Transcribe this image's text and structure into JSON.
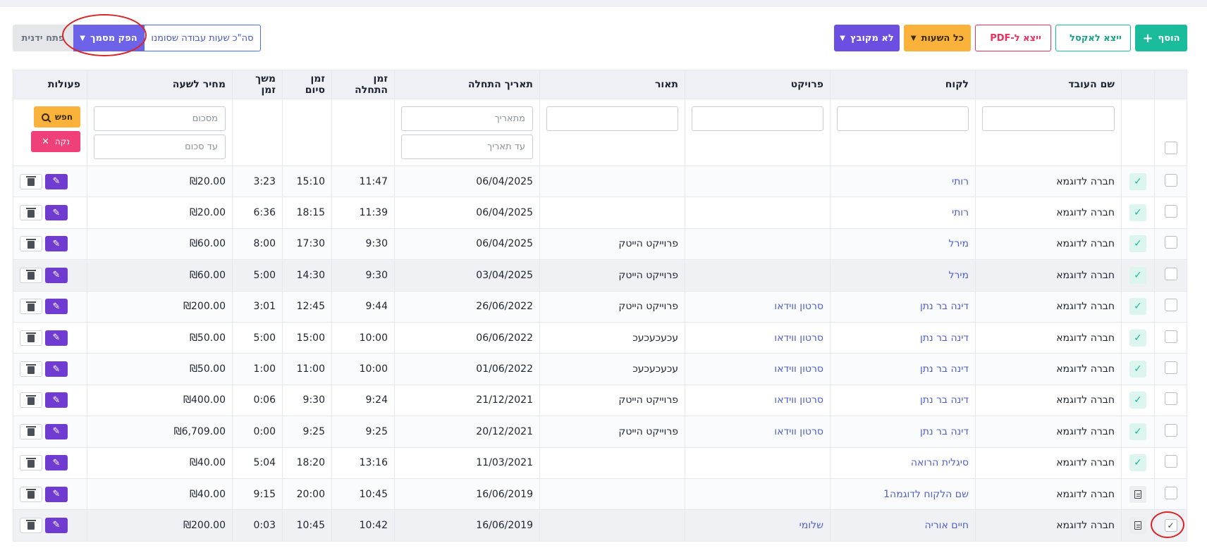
{
  "toolbar": {
    "add_label": "הוסף",
    "export_excel_label": "ייצא לאקסל",
    "export_pdf_label": "ייצא ל-PDF",
    "all_hours_label": "כל השעות",
    "not_grouped_label": "לא מקובץ",
    "manual_open_label": "פתח ידנית",
    "generate_doc_label": "הפק מסמך",
    "total_hours_label": "סה\"כ שעות עבודה שסומנו"
  },
  "table": {
    "headers": {
      "employee": "שם העובד",
      "client": "לקוח",
      "project": "פרויקט",
      "description": "תאור",
      "start_date": "תאריך התחלה",
      "start_time": "זמן התחלה",
      "end_time": "זמן סיום",
      "duration": "משך זמן",
      "hourly_rate": "מחיר לשעה",
      "actions": "פעולות"
    },
    "filters": {
      "from_date_placeholder": "מתאריך",
      "to_date_placeholder": "עד תאריך",
      "amount_placeholder": "מסכום",
      "to_amount_placeholder": "עד סכום",
      "search_label": "חפש",
      "clear_label": "נקה"
    },
    "rows": [
      {
        "status": "approved",
        "employee": "חברה לדוגמא",
        "client": "רותי",
        "project": "",
        "description": "",
        "date": "06/04/2025",
        "start": "11:47",
        "end": "15:10",
        "duration": "3:23",
        "rate": "₪20.00"
      },
      {
        "status": "approved",
        "employee": "חברה לדוגמא",
        "client": "רותי",
        "project": "",
        "description": "",
        "date": "06/04/2025",
        "start": "11:39",
        "end": "18:15",
        "duration": "6:36",
        "rate": "₪20.00"
      },
      {
        "status": "approved",
        "employee": "חברה לדוגמא",
        "client": "מירל",
        "project": "",
        "description": "פרוייקט הייטק",
        "date": "06/04/2025",
        "start": "9:30",
        "end": "17:30",
        "duration": "8:00",
        "rate": "₪60.00"
      },
      {
        "status": "approved",
        "employee": "חברה לדוגמא",
        "client": "מירל",
        "project": "",
        "description": "פרוייקט הייטק",
        "date": "03/04/2025",
        "start": "9:30",
        "end": "14:30",
        "duration": "5:00",
        "rate": "₪60.00"
      },
      {
        "status": "approved",
        "employee": "חברה לדוגמא",
        "client": "דינה בר נתן",
        "project": "סרטון ווידאו",
        "description": "פרוייקט הייטק",
        "date": "26/06/2022",
        "start": "9:44",
        "end": "12:45",
        "duration": "3:01",
        "rate": "₪200.00"
      },
      {
        "status": "approved",
        "employee": "חברה לדוגמא",
        "client": "דינה בר נתן",
        "project": "סרטון ווידאו",
        "description": "עכעכעכעכ",
        "date": "06/06/2022",
        "start": "10:00",
        "end": "15:00",
        "duration": "5:00",
        "rate": "₪50.00"
      },
      {
        "status": "approved",
        "employee": "חברה לדוגמא",
        "client": "דינה בר נתן",
        "project": "סרטון ווידאו",
        "description": "עכעכעכעכ",
        "date": "01/06/2022",
        "start": "10:00",
        "end": "11:00",
        "duration": "1:00",
        "rate": "₪50.00"
      },
      {
        "status": "approved",
        "employee": "חברה לדוגמא",
        "client": "דינה בר נתן",
        "project": "סרטון ווידאו",
        "description": "פרוייקט הייטק",
        "date": "21/12/2021",
        "start": "9:24",
        "end": "9:30",
        "duration": "0:06",
        "rate": "₪400.00"
      },
      {
        "status": "approved",
        "employee": "חברה לדוגמא",
        "client": "דינה בר נתן",
        "project": "סרטון ווידאו",
        "description": "פרוייקט הייטק",
        "date": "20/12/2021",
        "start": "9:25",
        "end": "9:25",
        "duration": "0:00",
        "rate": "₪6,709.00"
      },
      {
        "status": "approved",
        "employee": "חברה לדוגמא",
        "client": "סיגלית הרואה",
        "project": "",
        "description": "",
        "date": "11/03/2021",
        "start": "13:16",
        "end": "18:20",
        "duration": "5:04",
        "rate": "₪40.00"
      },
      {
        "status": "document",
        "employee": "חברה לדוגמא",
        "client": "שם הלקוח לדוגמה1",
        "project": "",
        "description": "",
        "date": "16/06/2019",
        "start": "10:45",
        "end": "20:00",
        "duration": "9:15",
        "rate": "₪40.00"
      },
      {
        "status": "document",
        "checked": true,
        "employee": "חברה לדוגמא",
        "client": "חיים אוריה",
        "project": "שלומי",
        "description": "",
        "date": "16/06/2019",
        "start": "10:42",
        "end": "10:45",
        "duration": "0:03",
        "rate": "₪200.00"
      }
    ]
  },
  "colors": {
    "accent_teal": "#1abc9c",
    "accent_purple": "#6c4ee0",
    "accent_yellow": "#fbb23b",
    "accent_pink": "#e8315f",
    "link_blue": "#4f5fcc",
    "annotation_red": "#d92525"
  },
  "icons": {
    "add": "plus-icon",
    "excel": "excel-file-icon",
    "pdf": "pdf-file-icon",
    "dropdown": "chevron-down-icon",
    "search": "search-icon",
    "clear": "close-icon",
    "edit": "pencil-icon",
    "delete": "trash-icon",
    "approved": "check-icon",
    "document": "document-icon"
  }
}
